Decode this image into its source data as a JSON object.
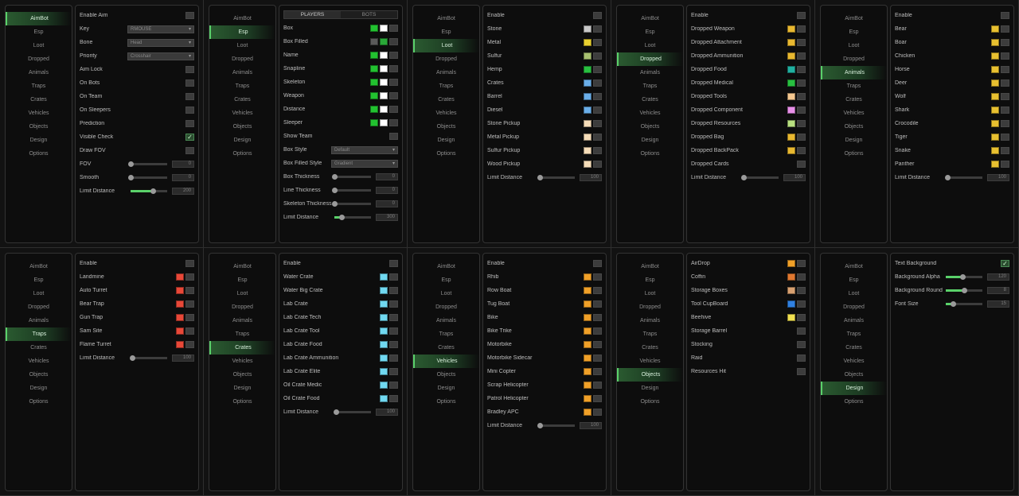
{
  "colors": {
    "accent": "#5ad16a",
    "active_nav": "#2a5a30"
  },
  "nav": [
    "AimBot",
    "Esp",
    "Loot",
    "Dropped",
    "Animals",
    "Traps",
    "Crates",
    "Vehicles",
    "Objects",
    "Design",
    "Options"
  ],
  "screens": [
    {
      "active": 0,
      "rows": [
        {
          "t": "check",
          "label": "Enable Aim"
        },
        {
          "t": "select",
          "label": "Key",
          "value": "RMOUSE"
        },
        {
          "t": "select",
          "label": "Bone",
          "value": "Head"
        },
        {
          "t": "select",
          "label": "Priority",
          "value": "Crosshair"
        },
        {
          "t": "check",
          "label": "Aim Lock"
        },
        {
          "t": "check",
          "label": "On Bots"
        },
        {
          "t": "check",
          "label": "On Team"
        },
        {
          "t": "check",
          "label": "On Sleepers"
        },
        {
          "t": "check",
          "label": "Prediction"
        },
        {
          "t": "check",
          "label": "Visible Check",
          "on": true
        },
        {
          "t": "check",
          "label": "Draw FOV"
        },
        {
          "t": "slider",
          "label": "FOV",
          "value": "0",
          "pct": 0
        },
        {
          "t": "slider",
          "label": "Smooth",
          "value": "0",
          "pct": 0
        },
        {
          "t": "slider",
          "label": "Limit Distance",
          "value": "200",
          "pct": 0.6
        }
      ]
    },
    {
      "active": 1,
      "tabs": [
        "PLAYERS",
        "BOTS"
      ],
      "rows": [
        {
          "t": "check",
          "label": "Box",
          "colors": [
            "#22c230",
            "#ffffff"
          ]
        },
        {
          "t": "check",
          "label": "Box Filled",
          "colors": [
            "#5a5a5a",
            "#2aa838"
          ]
        },
        {
          "t": "check",
          "label": "Name",
          "colors": [
            "#22c230",
            "#ffffff"
          ]
        },
        {
          "t": "check",
          "label": "Snapline",
          "colors": [
            "#22c230",
            "#ffffff"
          ]
        },
        {
          "t": "check",
          "label": "Skeleton",
          "colors": [
            "#22c230",
            "#ffffff"
          ]
        },
        {
          "t": "check",
          "label": "Weapon",
          "colors": [
            "#22c230",
            "#ffffff"
          ]
        },
        {
          "t": "check",
          "label": "Distance",
          "colors": [
            "#22c230",
            "#ffffff"
          ]
        },
        {
          "t": "check",
          "label": "Sleeper",
          "colors": [
            "#22c230",
            "#ffffff"
          ]
        },
        {
          "t": "check",
          "label": "Show Team"
        },
        {
          "t": "select",
          "label": "Box Style",
          "value": "Default"
        },
        {
          "t": "select",
          "label": "Box Filled Style",
          "value": "Gradient"
        },
        {
          "t": "slider",
          "label": "Box Thickness",
          "value": "0",
          "pct": 0
        },
        {
          "t": "slider",
          "label": "Line Thickness",
          "value": "0",
          "pct": 0
        },
        {
          "t": "slider",
          "label": "Skeleton Thickness",
          "value": "0",
          "pct": 0
        },
        {
          "t": "slider",
          "label": "Limit Distance",
          "value": "300",
          "pct": 0.2
        }
      ]
    },
    {
      "active": 2,
      "rows": [
        {
          "t": "check",
          "label": "Enable"
        },
        {
          "t": "check",
          "label": "Stone",
          "colors": [
            "#c8c8c8"
          ]
        },
        {
          "t": "check",
          "label": "Metal",
          "colors": [
            "#e8d030"
          ]
        },
        {
          "t": "check",
          "label": "Sulfur",
          "colors": [
            "#a8c070"
          ]
        },
        {
          "t": "check",
          "label": "Hemp",
          "colors": [
            "#28c040"
          ]
        },
        {
          "t": "check",
          "label": "Crates",
          "colors": [
            "#6aaee8"
          ]
        },
        {
          "t": "check",
          "label": "Barrel",
          "colors": [
            "#6aaee8"
          ]
        },
        {
          "t": "check",
          "label": "Diesel",
          "colors": [
            "#6aaee8"
          ]
        },
        {
          "t": "check",
          "label": "Stone Pickup",
          "colors": [
            "#f5dcb8"
          ]
        },
        {
          "t": "check",
          "label": "Metal Pickup",
          "colors": [
            "#f5dcb8"
          ]
        },
        {
          "t": "check",
          "label": "Sulfur Pickup",
          "colors": [
            "#f5dcb8"
          ]
        },
        {
          "t": "check",
          "label": "Wood Pickup",
          "colors": [
            "#f5dcb8"
          ]
        },
        {
          "t": "slider",
          "label": "Limit Distance",
          "value": "100",
          "pct": 0.05
        }
      ]
    },
    {
      "active": 3,
      "rows": [
        {
          "t": "check",
          "label": "Enable"
        },
        {
          "t": "check",
          "label": "Dropped Weapon",
          "colors": [
            "#e8b830"
          ]
        },
        {
          "t": "check",
          "label": "Dropped Attachment",
          "colors": [
            "#e8b830"
          ]
        },
        {
          "t": "check",
          "label": "Dropped Ammunition",
          "colors": [
            "#e8b830"
          ]
        },
        {
          "t": "check",
          "label": "Dropped Food",
          "colors": [
            "#20b0a0"
          ]
        },
        {
          "t": "check",
          "label": "Dropped Medical",
          "colors": [
            "#28c040"
          ]
        },
        {
          "t": "check",
          "label": "Dropped Tools",
          "colors": [
            "#f5c890"
          ]
        },
        {
          "t": "check",
          "label": "Dropped Component",
          "colors": [
            "#e890e8"
          ]
        },
        {
          "t": "check",
          "label": "Dropped Resources",
          "colors": [
            "#b8e080"
          ]
        },
        {
          "t": "check",
          "label": "Dropped Bag",
          "colors": [
            "#e8b830"
          ]
        },
        {
          "t": "check",
          "label": "Dropped BackPack",
          "colors": [
            "#e8b830"
          ]
        },
        {
          "t": "check",
          "label": "Dropped Cards"
        },
        {
          "t": "slider",
          "label": "Limit Distance",
          "value": "100",
          "pct": 0.05
        }
      ]
    },
    {
      "active": 4,
      "rows": [
        {
          "t": "check",
          "label": "Enable"
        },
        {
          "t": "check",
          "label": "Bear",
          "colors": [
            "#e8c030"
          ]
        },
        {
          "t": "check",
          "label": "Boar",
          "colors": [
            "#e8c030"
          ]
        },
        {
          "t": "check",
          "label": "Chicken",
          "colors": [
            "#e8c030"
          ]
        },
        {
          "t": "check",
          "label": "Horse",
          "colors": [
            "#e8c030"
          ]
        },
        {
          "t": "check",
          "label": "Deer",
          "colors": [
            "#e8c030"
          ]
        },
        {
          "t": "check",
          "label": "Wolf",
          "colors": [
            "#e8c030"
          ]
        },
        {
          "t": "check",
          "label": "Shark",
          "colors": [
            "#e8c030"
          ]
        },
        {
          "t": "check",
          "label": "Crocodile",
          "colors": [
            "#e8c030"
          ]
        },
        {
          "t": "check",
          "label": "Tiger",
          "colors": [
            "#e8c030"
          ]
        },
        {
          "t": "check",
          "label": "Snake",
          "colors": [
            "#e8c030"
          ]
        },
        {
          "t": "check",
          "label": "Panther",
          "colors": [
            "#e8c030"
          ]
        },
        {
          "t": "slider",
          "label": "Limit Distance",
          "value": "100",
          "pct": 0.05
        }
      ]
    },
    {
      "active": 5,
      "rows": [
        {
          "t": "check",
          "label": "Enable"
        },
        {
          "t": "check",
          "label": "Landmine",
          "colors": [
            "#e84838"
          ]
        },
        {
          "t": "check",
          "label": "Auto Turret",
          "colors": [
            "#e84838"
          ]
        },
        {
          "t": "check",
          "label": "Bear Trap",
          "colors": [
            "#e84838"
          ]
        },
        {
          "t": "check",
          "label": "Gun Trap",
          "colors": [
            "#e84838"
          ]
        },
        {
          "t": "check",
          "label": "Sam Site",
          "colors": [
            "#e84838"
          ]
        },
        {
          "t": "check",
          "label": "Flame Turret",
          "colors": [
            "#e84838"
          ]
        },
        {
          "t": "slider",
          "label": "Limit Distance",
          "value": "100",
          "pct": 0.05
        }
      ]
    },
    {
      "active": 6,
      "rows": [
        {
          "t": "check",
          "label": "Enable"
        },
        {
          "t": "check",
          "label": "Water Crate",
          "colors": [
            "#70d8f0"
          ]
        },
        {
          "t": "check",
          "label": "Water Big Crate",
          "colors": [
            "#70d8f0"
          ]
        },
        {
          "t": "check",
          "label": "Lab Crate",
          "colors": [
            "#70d8f0"
          ]
        },
        {
          "t": "check",
          "label": "Lab Crate Tech",
          "colors": [
            "#70d8f0"
          ]
        },
        {
          "t": "check",
          "label": "Lab Crate Tool",
          "colors": [
            "#70d8f0"
          ]
        },
        {
          "t": "check",
          "label": "Lab Crate Food",
          "colors": [
            "#70d8f0"
          ]
        },
        {
          "t": "check",
          "label": "Lab Crate Ammunition",
          "colors": [
            "#70d8f0"
          ]
        },
        {
          "t": "check",
          "label": "Lab Crate Elite",
          "colors": [
            "#70d8f0"
          ]
        },
        {
          "t": "check",
          "label": "Oil Crate Medic",
          "colors": [
            "#70d8f0"
          ]
        },
        {
          "t": "check",
          "label": "Oil Crate Food",
          "colors": [
            "#70d8f0"
          ]
        },
        {
          "t": "slider",
          "label": "Limit Distance",
          "value": "100",
          "pct": 0.05
        }
      ]
    },
    {
      "active": 7,
      "rows": [
        {
          "t": "check",
          "label": "Enable"
        },
        {
          "t": "check",
          "label": "Rhib",
          "colors": [
            "#f0a028"
          ]
        },
        {
          "t": "check",
          "label": "Row Boat",
          "colors": [
            "#f0a028"
          ]
        },
        {
          "t": "check",
          "label": "Tug Boat",
          "colors": [
            "#f0a028"
          ]
        },
        {
          "t": "check",
          "label": "Bike",
          "colors": [
            "#f0a028"
          ]
        },
        {
          "t": "check",
          "label": "Bike Trike",
          "colors": [
            "#f0a028"
          ]
        },
        {
          "t": "check",
          "label": "Motorbike",
          "colors": [
            "#f0a028"
          ]
        },
        {
          "t": "check",
          "label": "Motorbike Sidecar",
          "colors": [
            "#f0a028"
          ]
        },
        {
          "t": "check",
          "label": "Mini Copter",
          "colors": [
            "#f0a028"
          ]
        },
        {
          "t": "check",
          "label": "Scrap Helicopter",
          "colors": [
            "#f0a028"
          ]
        },
        {
          "t": "check",
          "label": "Patrol Helicopter",
          "colors": [
            "#f0a028"
          ]
        },
        {
          "t": "check",
          "label": "Bradley APC",
          "colors": [
            "#f0a028"
          ]
        },
        {
          "t": "slider",
          "label": "Limit Distance",
          "value": "100",
          "pct": 0.05
        }
      ]
    },
    {
      "active": 8,
      "rows": [
        {
          "t": "check",
          "label": "AirDrop",
          "colors": [
            "#f0a028"
          ]
        },
        {
          "t": "check",
          "label": "Coffin",
          "colors": [
            "#e07830"
          ]
        },
        {
          "t": "check",
          "label": "Storage Boxes",
          "colors": [
            "#d8a070"
          ]
        },
        {
          "t": "check",
          "label": "Tool CupBoard",
          "colors": [
            "#3080e0"
          ]
        },
        {
          "t": "check",
          "label": "Beehive",
          "colors": [
            "#f0e050"
          ]
        },
        {
          "t": "check",
          "label": "Storage Barrel"
        },
        {
          "t": "check",
          "label": "Stocking"
        },
        {
          "t": "check",
          "label": "Raid"
        },
        {
          "t": "check",
          "label": "Resources Hit"
        }
      ]
    },
    {
      "active": 9,
      "rows": [
        {
          "t": "check",
          "label": "Text Background",
          "on": true
        },
        {
          "t": "slider",
          "label": "Background Alpha",
          "value": "120",
          "pct": 0.45
        },
        {
          "t": "slider",
          "label": "Background Round",
          "value": "8",
          "pct": 0.5
        },
        {
          "t": "slider",
          "label": "Font Size",
          "value": "15",
          "pct": 0.2
        }
      ]
    }
  ]
}
